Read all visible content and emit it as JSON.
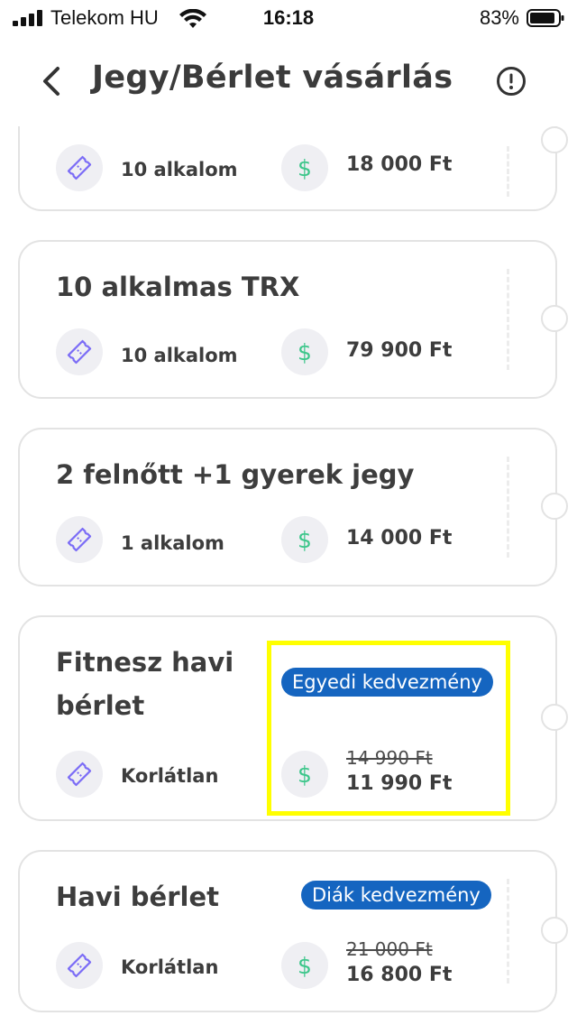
{
  "status_bar": {
    "carrier": "Telekom HU",
    "time": "16:18",
    "battery": "83%"
  },
  "header": {
    "title": "Jegy/Bérlet vásárlás"
  },
  "cards": [
    {
      "title": "",
      "uses": "10 alkalom",
      "price": "18 000 Ft"
    },
    {
      "title": "10 alkalmas TRX",
      "uses": "10 alkalom",
      "price": "79 900 Ft"
    },
    {
      "title": "2 felnőtt +1 gyerek jegy",
      "uses": "1 alkalom",
      "price": "14 000 Ft"
    },
    {
      "title_line1": "Fitnesz havi",
      "title_line2": "bérlet",
      "uses": "Korlátlan",
      "badge": "Egyedi kedvezmény",
      "old_price": "14 990 Ft",
      "price": "11 990 Ft"
    },
    {
      "title": "Havi bérlet",
      "uses": "Korlátlan",
      "badge": "Diák kedvezmény",
      "old_price": "21 000 Ft",
      "price": "16 800 Ft"
    }
  ],
  "icons": {
    "uses": "ticket-icon",
    "price": "dollar-icon"
  },
  "colors": {
    "badge": "#1565c0",
    "ticket_icon": "#7b6cf6",
    "dollar_icon": "#3cc68a",
    "highlight": "#ffff00"
  }
}
